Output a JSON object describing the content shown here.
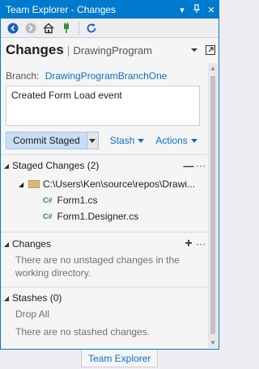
{
  "window": {
    "title": "Team Explorer - Changes",
    "buttons": [
      "▾",
      "⊅",
      "✕"
    ]
  },
  "toolbar": {
    "icons": [
      "back-icon",
      "forward-icon",
      "home-icon",
      "connect-icon",
      "refresh-icon"
    ]
  },
  "header": {
    "page_title": "Changes",
    "divider": "|",
    "project": "DrawingProgram"
  },
  "branch": {
    "label": "Branch:",
    "value": "DrawingProgramBranchOne"
  },
  "commit_message": "Created Form Load event",
  "actions": {
    "commit_label": "Commit Staged",
    "stash_label": "Stash",
    "actions_label": "Actions"
  },
  "staged": {
    "title": "Staged Changes (2)",
    "folder": "C:\\Users\\Ken\\source\\repos\\Drawi...",
    "files": [
      "Form1.cs",
      "Form1.Designer.cs"
    ],
    "file_badge": "C#"
  },
  "changes": {
    "title": "Changes",
    "empty_text": "There are no unstaged changes in the working directory."
  },
  "stashes": {
    "title": "Stashes (0)",
    "drop_all": "Drop All",
    "empty_text": "There are no stashed changes."
  },
  "footer": {
    "tab_label": "Team Explorer"
  },
  "colors": {
    "accent": "#007acc",
    "link": "#0e70c0",
    "csharp": "#388a34"
  }
}
